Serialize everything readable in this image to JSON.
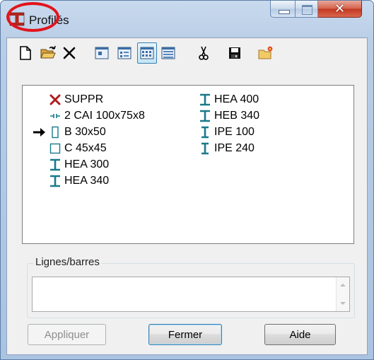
{
  "window": {
    "title": "Profilés",
    "app_icon": "i-beam-icon",
    "accent": "#c0392b"
  },
  "titlebar_buttons": [
    "minimize",
    "maximize",
    "close"
  ],
  "toolbar": {
    "buttons": [
      {
        "name": "new-button",
        "icon": "new-document-icon"
      },
      {
        "name": "open-button",
        "icon": "open-folder-icon"
      },
      {
        "name": "delete-button",
        "icon": "delete-x-icon"
      },
      {
        "name": "view-large-icons-button",
        "icon": "large-icons-view-icon"
      },
      {
        "name": "view-small-icons-button",
        "icon": "small-icons-view-icon"
      },
      {
        "name": "view-list-button",
        "icon": "list-view-icon",
        "pressed": true
      },
      {
        "name": "view-details-button",
        "icon": "details-view-icon"
      },
      {
        "name": "cut-button",
        "icon": "scissors-icon"
      },
      {
        "name": "save-button",
        "icon": "floppy-disk-icon"
      },
      {
        "name": "folder-options-button",
        "icon": "folder-star-icon"
      }
    ]
  },
  "profiles": [
    {
      "label": "SUPPR",
      "icon": "delete-x-icon",
      "color": "#b01c1c"
    },
    {
      "label": "2 CAI 100x75x8",
      "icon": "double-angle-icon",
      "color": "#1a7a8a"
    },
    {
      "label": "B 30x50",
      "icon": "rectangle-section-icon",
      "color": "#1a7a8a",
      "selected_arrow": true
    },
    {
      "label": "C 45x45",
      "icon": "square-section-icon",
      "color": "#1a7a8a"
    },
    {
      "label": "HEA 300",
      "icon": "i-beam-icon",
      "color": "#1a7a8a"
    },
    {
      "label": "HEA 340",
      "icon": "i-beam-icon",
      "color": "#1a7a8a"
    },
    {
      "label": "HEA 400",
      "icon": "i-beam-icon",
      "color": "#1a7a8a"
    },
    {
      "label": "HEB 340",
      "icon": "i-beam-icon",
      "color": "#1a7a8a"
    },
    {
      "label": "IPE 100",
      "icon": "i-beam-icon",
      "color": "#1a7a8a"
    },
    {
      "label": "IPE 240",
      "icon": "i-beam-icon",
      "color": "#1a7a8a"
    }
  ],
  "lines_group": {
    "label": "Lignes/barres",
    "value": ""
  },
  "buttons": {
    "apply": "Appliquer",
    "close": "Fermer",
    "help": "Aide"
  }
}
